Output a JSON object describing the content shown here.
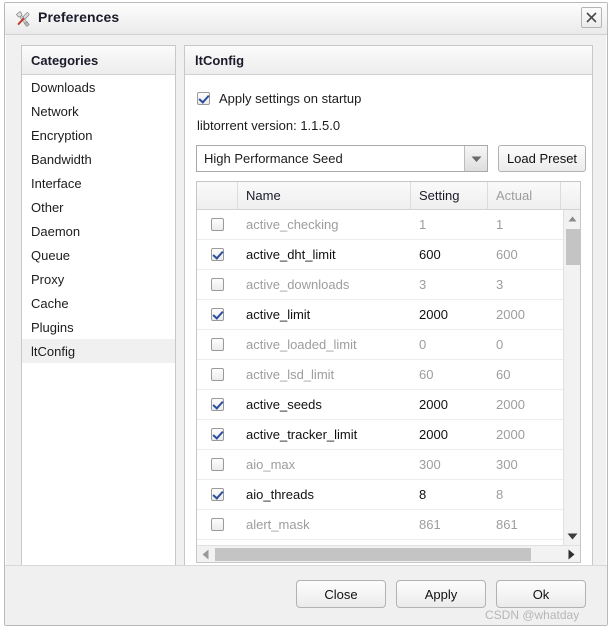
{
  "window": {
    "title": "Preferences",
    "icon": "tools-icon",
    "close_label": "×"
  },
  "sidebar": {
    "header": "Categories",
    "items": [
      {
        "label": "Downloads",
        "selected": false
      },
      {
        "label": "Network",
        "selected": false
      },
      {
        "label": "Encryption",
        "selected": false
      },
      {
        "label": "Bandwidth",
        "selected": false
      },
      {
        "label": "Interface",
        "selected": false
      },
      {
        "label": "Other",
        "selected": false
      },
      {
        "label": "Daemon",
        "selected": false
      },
      {
        "label": "Queue",
        "selected": false
      },
      {
        "label": "Proxy",
        "selected": false
      },
      {
        "label": "Cache",
        "selected": false
      },
      {
        "label": "Plugins",
        "selected": false
      },
      {
        "label": "ltConfig",
        "selected": true
      }
    ]
  },
  "panel": {
    "header": "ltConfig",
    "apply_on_startup": {
      "label": "Apply settings on startup",
      "checked": true
    },
    "version_line": "libtorrent version: 1.1.5.0",
    "preset": {
      "selected": "High Performance Seed",
      "load_button": "Load Preset"
    },
    "table": {
      "columns": [
        "",
        "Name",
        "Setting",
        "Actual"
      ],
      "rows": [
        {
          "checked": false,
          "name": "active_checking",
          "setting": "1",
          "actual": "1"
        },
        {
          "checked": true,
          "name": "active_dht_limit",
          "setting": "600",
          "actual": "600"
        },
        {
          "checked": false,
          "name": "active_downloads",
          "setting": "3",
          "actual": "3"
        },
        {
          "checked": true,
          "name": "active_limit",
          "setting": "2000",
          "actual": "2000"
        },
        {
          "checked": false,
          "name": "active_loaded_limit",
          "setting": "0",
          "actual": "0"
        },
        {
          "checked": false,
          "name": "active_lsd_limit",
          "setting": "60",
          "actual": "60"
        },
        {
          "checked": true,
          "name": "active_seeds",
          "setting": "2000",
          "actual": "2000"
        },
        {
          "checked": true,
          "name": "active_tracker_limit",
          "setting": "2000",
          "actual": "2000"
        },
        {
          "checked": false,
          "name": "aio_max",
          "setting": "300",
          "actual": "300"
        },
        {
          "checked": true,
          "name": "aio_threads",
          "setting": "8",
          "actual": "8"
        },
        {
          "checked": false,
          "name": "alert_mask",
          "setting": "861",
          "actual": "861"
        }
      ]
    }
  },
  "footer": {
    "close": "Close",
    "apply": "Apply",
    "ok": "Ok"
  },
  "watermark": "CSDN @whatday",
  "colors": {
    "accent": "#2b4f9c",
    "scrollbar_thumb": "#c4c4c4",
    "selected_row": "#f0f0f0",
    "muted_text": "#9d9d9d"
  }
}
